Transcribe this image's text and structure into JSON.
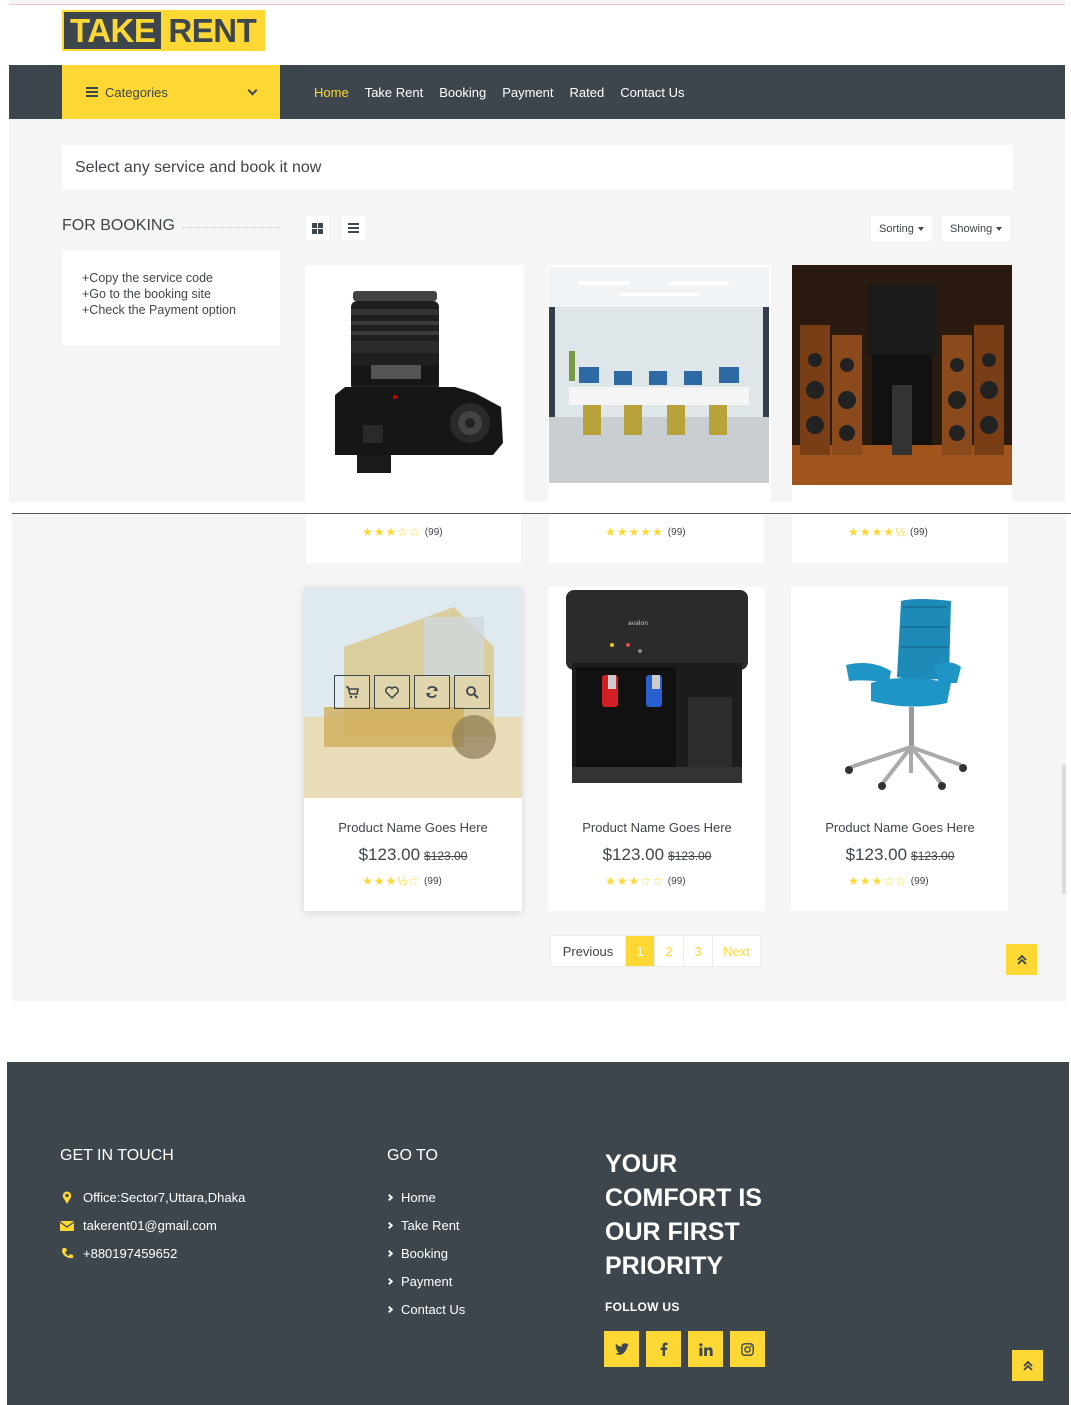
{
  "brand": {
    "part1": "TAKE",
    "part2": "RENT"
  },
  "nav": {
    "categories_label": "Categories",
    "links": [
      "Home",
      "Take Rent",
      "Booking",
      "Payment",
      "Rated",
      "Contact Us"
    ],
    "active": "Home"
  },
  "banner": {
    "text": "Select any service and book it now"
  },
  "sidebar": {
    "title": "FOR BOOKING",
    "steps": [
      "+Copy the service code",
      "+Go to the booking site",
      "+Check the Payment option"
    ]
  },
  "toolbar": {
    "sorting_label": "Sorting",
    "showing_label": "Showing"
  },
  "products_top": [
    {
      "image": "camera",
      "rating": 3,
      "reviews": "(99)"
    },
    {
      "image": "office",
      "rating": 5,
      "reviews": "(99)"
    },
    {
      "image": "speakers",
      "rating": 4.5,
      "reviews": "(99)"
    }
  ],
  "products_bottom": [
    {
      "image": "harvester",
      "name": "Product Name Goes Here",
      "price": "$123.00",
      "old_price": "$123.00",
      "rating": 3.5,
      "reviews": "(99)"
    },
    {
      "image": "water-dispenser",
      "name": "Product Name Goes Here",
      "price": "$123.00",
      "old_price": "$123.00",
      "rating": 3,
      "reviews": "(99)"
    },
    {
      "image": "office-chair",
      "name": "Product Name Goes Here",
      "price": "$123.00",
      "old_price": "$123.00",
      "rating": 3,
      "reviews": "(99)"
    }
  ],
  "dispenser_brand": "avalon",
  "pagination": {
    "previous": "Previous",
    "pages": [
      "1",
      "2",
      "3"
    ],
    "current": "1",
    "next": "Next"
  },
  "footer": {
    "contact_title": "GET IN TOUCH",
    "address": "Office:Sector7,Uttara,Dhaka",
    "email": "takerent01@gmail.com",
    "phone": "+880197459652",
    "goto_title": "GO TO",
    "goto_links": [
      "Home",
      "Take Rent",
      "Booking",
      "Payment",
      "Contact Us"
    ],
    "slogan": "YOUR COMFORT IS OUR FIRST PRIORITY",
    "follow_title": "FOLLOW US",
    "social": [
      "twitter-icon",
      "facebook-icon",
      "linkedin-icon",
      "instagram-icon"
    ]
  },
  "colors": {
    "primary": "#fdd835",
    "dark": "#3d464d",
    "light_bg": "#f5f5f5"
  }
}
